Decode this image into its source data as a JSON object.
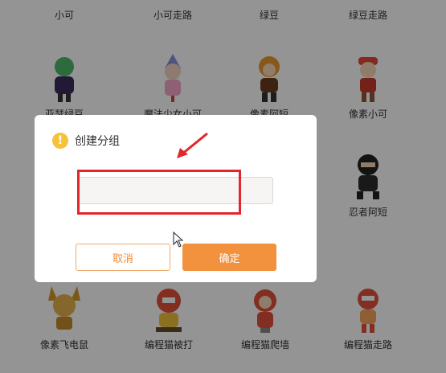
{
  "gallery": {
    "row1": [
      "小可",
      "小可走路",
      "绿豆",
      "绿豆走路"
    ],
    "row2": [
      "亚瑟绿豆",
      "魔法少女小可",
      "像素阿短",
      "像素小可"
    ],
    "row3": [
      "",
      "",
      "",
      "忍者阿短"
    ],
    "row4": [
      "像素飞电鼠",
      "编程猫被打",
      "编程猫爬墙",
      "编程猫走路"
    ]
  },
  "dialog": {
    "title": "创建分组",
    "input_value": "",
    "cancel_label": "取消",
    "confirm_label": "确定"
  },
  "colors": {
    "accent": "#f2913e",
    "warning": "#f6c23a",
    "highlight": "#e2262a"
  }
}
